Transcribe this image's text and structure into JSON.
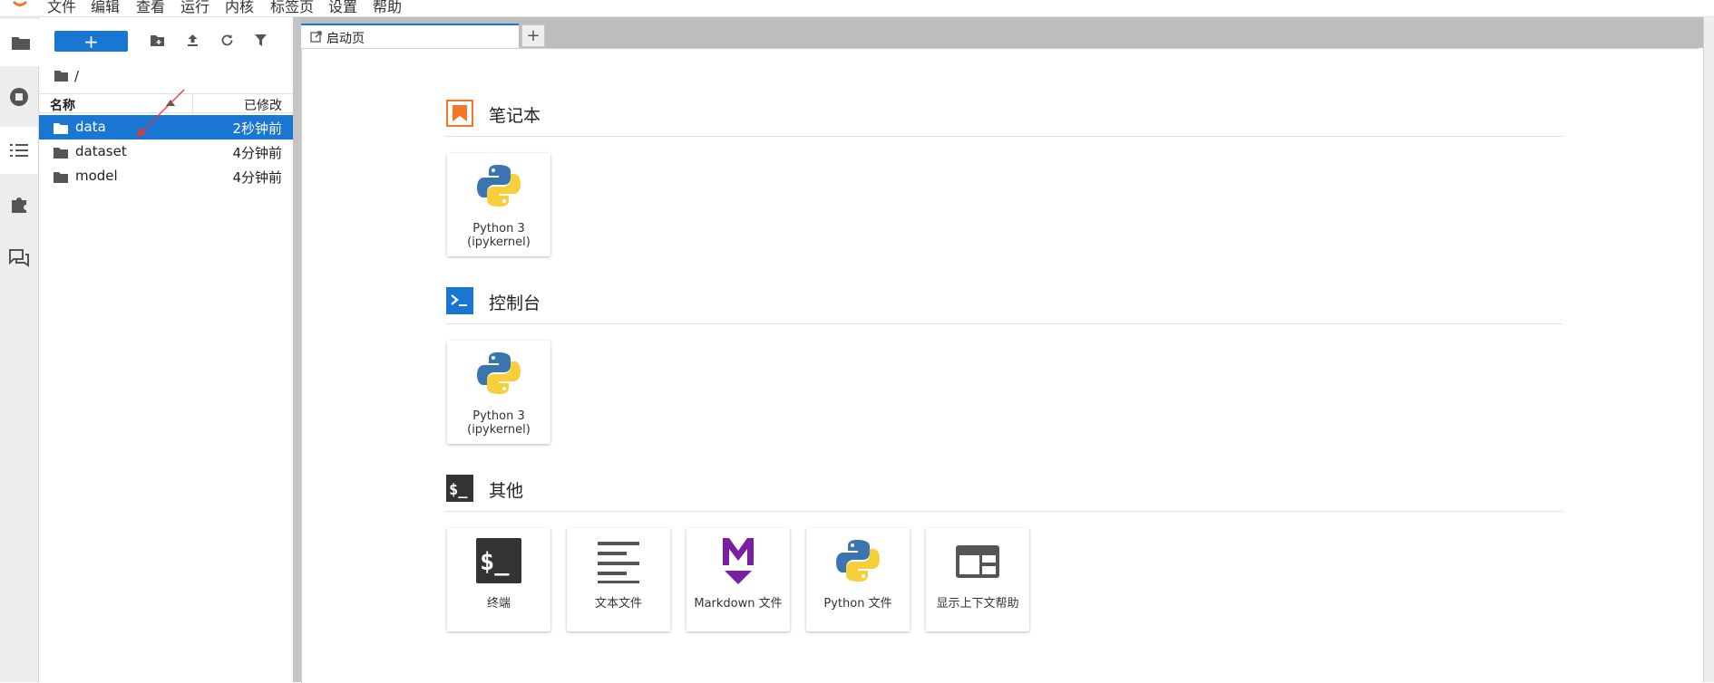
{
  "menubar": {
    "items": [
      "文件",
      "编辑",
      "查看",
      "运行",
      "内核",
      "标签页",
      "设置",
      "帮助"
    ]
  },
  "browser": {
    "new_label": "+",
    "breadcrumb": "/",
    "columns": {
      "name": "名称",
      "modified": "已修改"
    },
    "files": [
      {
        "name": "data",
        "modified": "2秒钟前",
        "selected": true
      },
      {
        "name": "dataset",
        "modified": "4分钟前",
        "selected": false
      },
      {
        "name": "model",
        "modified": "4分钟前",
        "selected": false
      }
    ]
  },
  "tabs": [
    {
      "label": "启动页",
      "icon": "launcher-tab-icon"
    }
  ],
  "tab_add_label": "+",
  "launcher": {
    "sections": [
      {
        "title": "笔记本",
        "icon": "notebook-icon",
        "cards": [
          {
            "label": "Python 3 (ipykernel)",
            "icon": "python-logo-icon"
          }
        ]
      },
      {
        "title": "控制台",
        "icon": "console-icon",
        "cards": [
          {
            "label": "Python 3 (ipykernel)",
            "icon": "python-logo-icon"
          }
        ]
      },
      {
        "title": "其他",
        "icon": "other-terminal-icon",
        "cards": [
          {
            "label": "终端",
            "icon": "terminal-icon"
          },
          {
            "label": "文本文件",
            "icon": "text-file-icon"
          },
          {
            "label": "Markdown 文件",
            "icon": "markdown-icon"
          },
          {
            "label": "Python 文件",
            "icon": "python-logo-icon"
          },
          {
            "label": "显示上下文帮助",
            "icon": "context-help-icon"
          }
        ]
      }
    ]
  },
  "colors": {
    "accent": "#1976d2",
    "notebook_orange": "#f37726",
    "markdown_purple": "#7b1fa2",
    "python_blue": "#3a75b0",
    "python_yellow": "#f7cf3b",
    "annotation_red": "#e53935"
  }
}
